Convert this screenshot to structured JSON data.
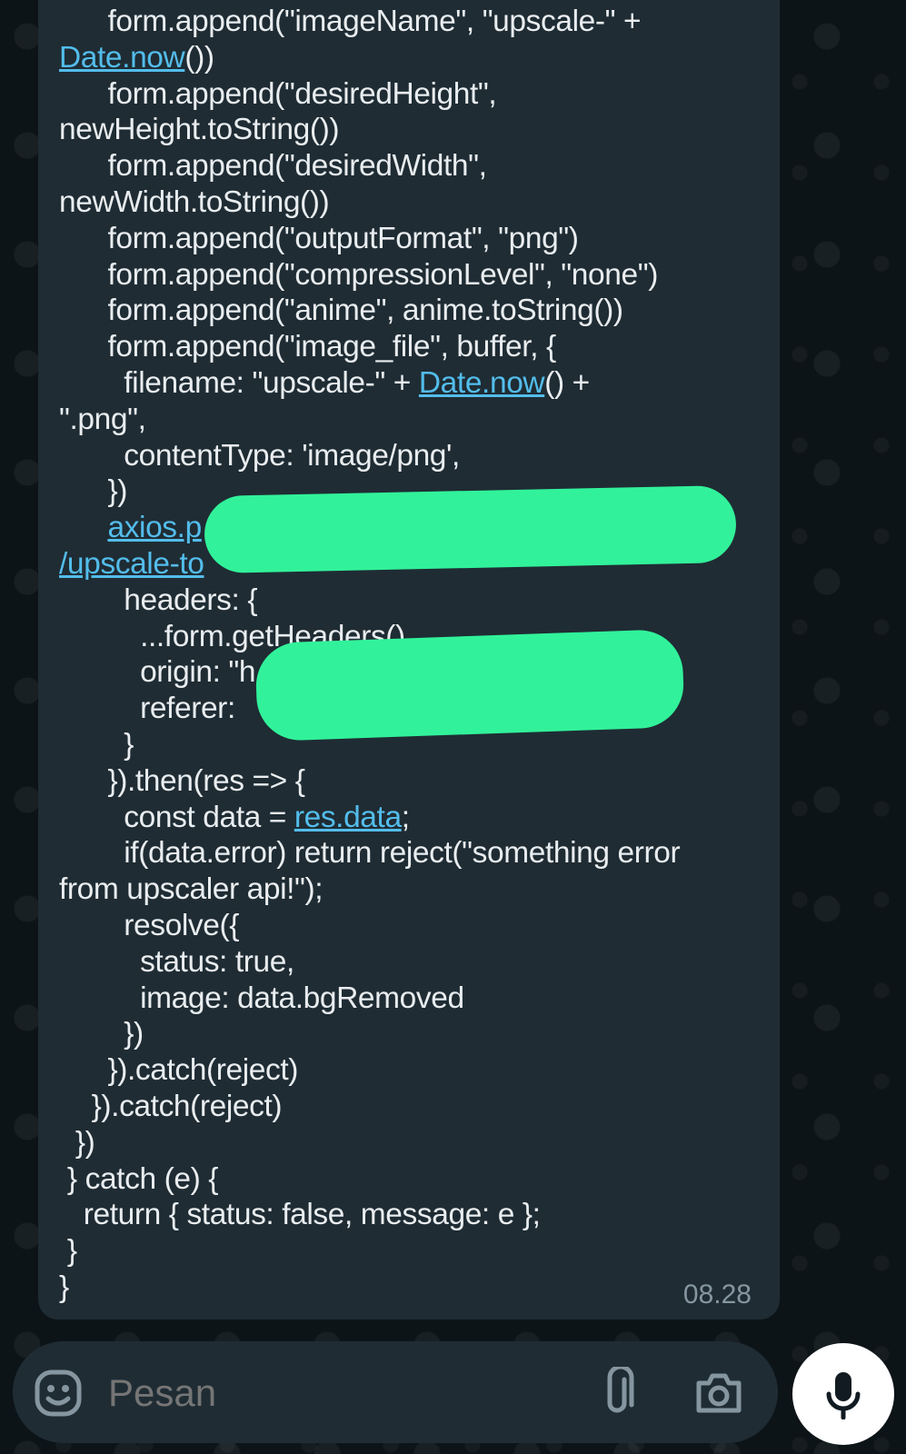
{
  "message": {
    "code_lines": [
      {
        "pre": "      form.append(\"imageName\", \"upscale-\" + "
      },
      {
        "pre": "",
        "link": "Date.now",
        "post": "())"
      },
      {
        "pre": "      form.append(\"desiredHeight\", "
      },
      {
        "pre": "newHeight.toString())"
      },
      {
        "pre": "      form.append(\"desiredWidth\", "
      },
      {
        "pre": "newWidth.toString())"
      },
      {
        "pre": "      form.append(\"outputFormat\", \"png\")"
      },
      {
        "pre": "      form.append(\"compressionLevel\", \"none\")"
      },
      {
        "pre": "      form.append(\"anime\", anime.toString())"
      },
      {
        "pre": "      form.append(\"image_file\", buffer, {"
      },
      {
        "pre": "        filename: \"upscale-\" + ",
        "link": "Date.now",
        "post": "() +"
      },
      {
        "pre": "\".png\","
      },
      {
        "pre": "        contentType: 'image/png',"
      },
      {
        "pre": "      })"
      },
      {
        "pre": "      ",
        "link": "axios.p",
        "post": ""
      },
      {
        "pre": "",
        "link": "/upscale-to",
        "post": ""
      },
      {
        "pre": "        headers: {"
      },
      {
        "pre": "          ...form.getHeaders(),"
      },
      {
        "pre": "          origin: \"h"
      },
      {
        "pre": "          referer:"
      },
      {
        "pre": "        }"
      },
      {
        "pre": "      }).then(res => {"
      },
      {
        "pre": "        const data = ",
        "link": "res.data",
        "post": ";"
      },
      {
        "pre": "        if(data.error) return reject(\"something error "
      },
      {
        "pre": "from upscaler api!\");"
      },
      {
        "pre": "        resolve({"
      },
      {
        "pre": "          status: true,"
      },
      {
        "pre": "          image: data.bgRemoved"
      },
      {
        "pre": "        })"
      },
      {
        "pre": "      }).catch(reject)"
      },
      {
        "pre": "    }).catch(reject)"
      },
      {
        "pre": "  })"
      },
      {
        "pre": " } catch (e) {"
      },
      {
        "pre": "   return { status: false, message: e };"
      },
      {
        "pre": " }"
      },
      {
        "pre": "}"
      }
    ],
    "time": "08.28"
  },
  "composer": {
    "placeholder": "Pesan"
  },
  "icons": {
    "emoji": "emoji-icon",
    "attach": "paperclip-icon",
    "camera": "camera-icon",
    "mic": "microphone-icon"
  },
  "colors": {
    "redaction": "#31f29a",
    "link": "#53bdeb",
    "bubble": "#1f2c34"
  }
}
